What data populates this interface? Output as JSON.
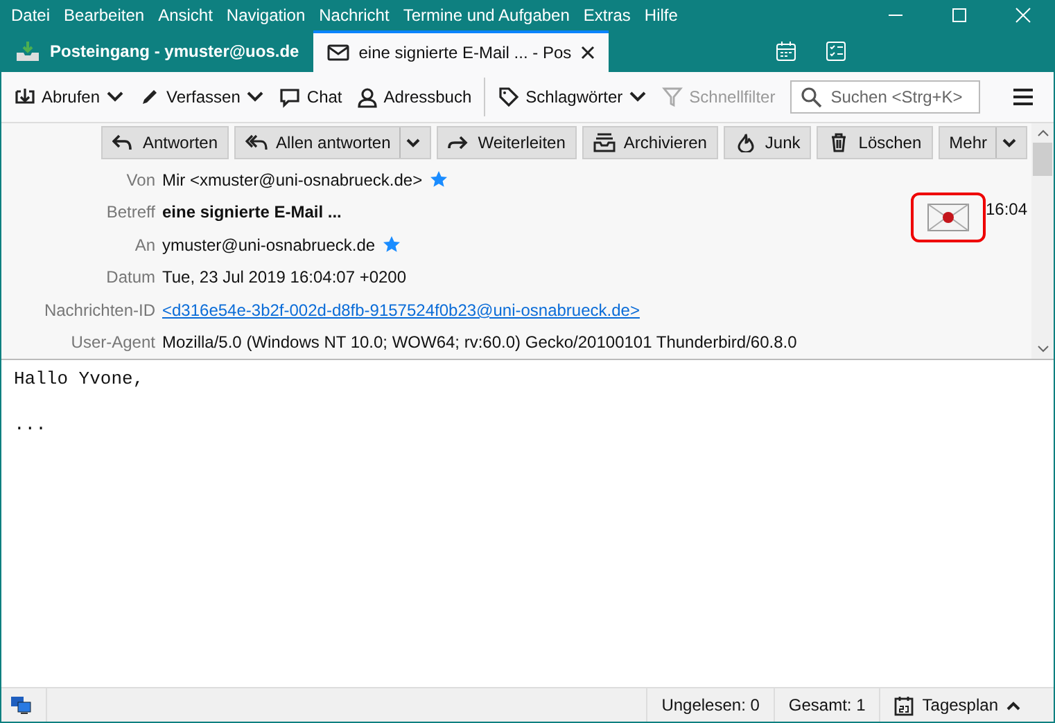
{
  "menu": [
    "Datei",
    "Bearbeiten",
    "Ansicht",
    "Navigation",
    "Nachricht",
    "Termine und Aufgaben",
    "Extras",
    "Hilfe"
  ],
  "tabs": [
    {
      "label": "Posteingang - ymuster@uos.de",
      "selected": false
    },
    {
      "label": "eine signierte E-Mail ... - Pos",
      "selected": true
    }
  ],
  "toolbar": [
    {
      "label": "Abrufen",
      "dropdown": true,
      "disabled": false
    },
    {
      "label": "Verfassen",
      "dropdown": true,
      "disabled": false
    },
    {
      "label": "Chat",
      "dropdown": false,
      "disabled": false
    },
    {
      "label": "Adressbuch",
      "dropdown": false,
      "disabled": false
    },
    {
      "label": "Schlagwörter",
      "dropdown": true,
      "disabled": false
    },
    {
      "label": "Schnellfilter",
      "dropdown": false,
      "disabled": true
    }
  ],
  "search": {
    "placeholder": "Suchen <Strg+K>"
  },
  "actions": [
    {
      "label": "Antworten",
      "dropdown": false
    },
    {
      "label": "Allen antworten",
      "dropdown": true
    },
    {
      "label": "Weiterleiten",
      "dropdown": false
    },
    {
      "label": "Archivieren",
      "dropdown": false
    },
    {
      "label": "Junk",
      "dropdown": false
    },
    {
      "label": "Löschen",
      "dropdown": false
    },
    {
      "label": "Mehr",
      "dropdown": true
    }
  ],
  "headers": [
    {
      "label": "Von",
      "value": "Mir <xmuster@uni-osnabrueck.de>",
      "kind": "text",
      "starred": true
    },
    {
      "label": "Betreff",
      "value": "eine signierte E-Mail ...",
      "kind": "bold",
      "starred": false
    },
    {
      "label": "An",
      "value": "ymuster@uni-osnabrueck.de",
      "kind": "text",
      "starred": true
    },
    {
      "label": "Datum",
      "value": "Tue, 23 Jul 2019 16:04:07 +0200",
      "kind": "text",
      "starred": false
    },
    {
      "label": "Nachrichten-ID",
      "value": "<d316e54e-3b2f-002d-d8fb-9157524f0b23@uni-osnabrueck.de>",
      "kind": "link",
      "starred": false
    },
    {
      "label": "User-Agent",
      "value": "Mozilla/5.0 (Windows NT 10.0; WOW64; rv:60.0) Gecko/20100101 Thunderbird/60.8.0",
      "kind": "text",
      "starred": false
    }
  ],
  "time": "16:04",
  "body": [
    "Hallo Yvone,",
    "..."
  ],
  "status_bar": {
    "unread": "Ungelesen: 0",
    "total": "Gesamt: 1",
    "today": "Tagesplan"
  }
}
